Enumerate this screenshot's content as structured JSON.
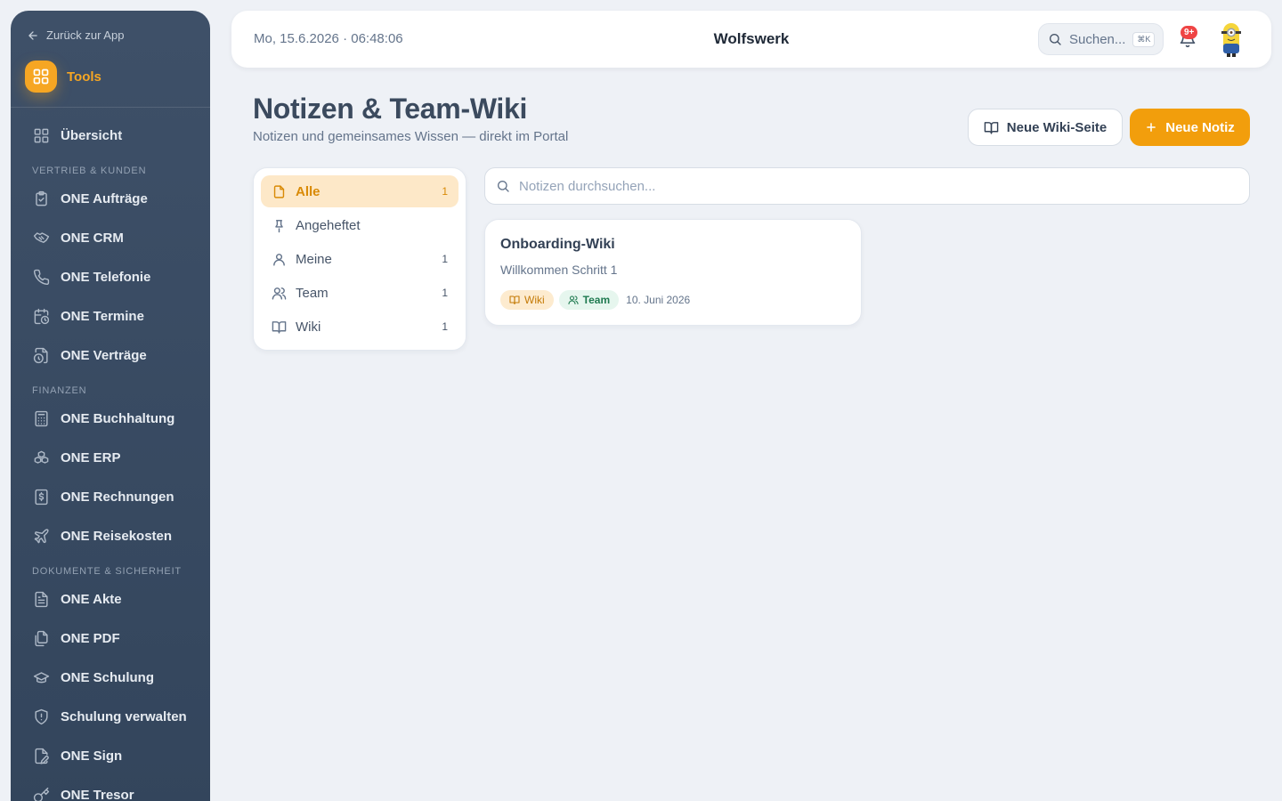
{
  "sidebar": {
    "back_label": "Zurück zur App",
    "tools_label": "Tools",
    "overview_label": "Übersicht",
    "sections": [
      {
        "title": "Vertrieb & Kunden",
        "items": [
          {
            "label": "ONE Aufträge",
            "icon": "clipboard-check-icon"
          },
          {
            "label": "ONE CRM",
            "icon": "handshake-icon"
          },
          {
            "label": "ONE Telefonie",
            "icon": "phone-icon"
          },
          {
            "label": "ONE Termine",
            "icon": "calendar-clock-icon"
          },
          {
            "label": "ONE Verträge",
            "icon": "file-clock-icon"
          }
        ]
      },
      {
        "title": "Finanzen",
        "items": [
          {
            "label": "ONE Buchhaltung",
            "icon": "calculator-icon"
          },
          {
            "label": "ONE ERP",
            "icon": "boxes-icon"
          },
          {
            "label": "ONE Rechnungen",
            "icon": "receipt-icon"
          },
          {
            "label": "ONE Reisekosten",
            "icon": "plane-icon"
          }
        ]
      },
      {
        "title": "Dokumente & Sicherheit",
        "items": [
          {
            "label": "ONE Akte",
            "icon": "file-text-icon"
          },
          {
            "label": "ONE PDF",
            "icon": "files-icon"
          },
          {
            "label": "ONE Schulung",
            "icon": "graduation-cap-icon"
          },
          {
            "label": "Schulung verwalten",
            "icon": "shield-icon"
          },
          {
            "label": "ONE Sign",
            "icon": "file-signature-icon"
          },
          {
            "label": "ONE Tresor",
            "icon": "key-icon"
          }
        ]
      }
    ]
  },
  "topbar": {
    "datetime": "Mo, 15.6.2026 · 06:48:06",
    "brand": "Wolfswerk",
    "search_label": "Suchen...",
    "search_shortcut": "⌘K",
    "notification_count": "9+"
  },
  "header": {
    "title": "Notizen & Team-Wiki",
    "subtitle": "Notizen und gemeinsames Wissen — direkt im Portal",
    "wiki_button": "Neue Wiki-Seite",
    "new_button": "Neue Notiz"
  },
  "filters": [
    {
      "label": "Alle",
      "count": "1",
      "icon": "file-icon",
      "active": true
    },
    {
      "label": "Angeheftet",
      "count": "",
      "icon": "pin-icon",
      "active": false
    },
    {
      "label": "Meine",
      "count": "1",
      "icon": "user-icon",
      "active": false
    },
    {
      "label": "Team",
      "count": "1",
      "icon": "users-icon",
      "active": false
    },
    {
      "label": "Wiki",
      "count": "1",
      "icon": "book-icon",
      "active": false
    }
  ],
  "search": {
    "placeholder": "Notizen durchsuchen...",
    "value": ""
  },
  "notes": [
    {
      "title": "Onboarding-Wiki",
      "excerpt": "Willkommen Schritt 1",
      "tag_wiki": "Wiki",
      "tag_team": "Team",
      "date": "10. Juni 2026"
    }
  ],
  "colors": {
    "accent": "#f29e0c",
    "sidebar_bg": "#3a4b62",
    "background": "#eef1f6",
    "badge": "#ef4444"
  }
}
